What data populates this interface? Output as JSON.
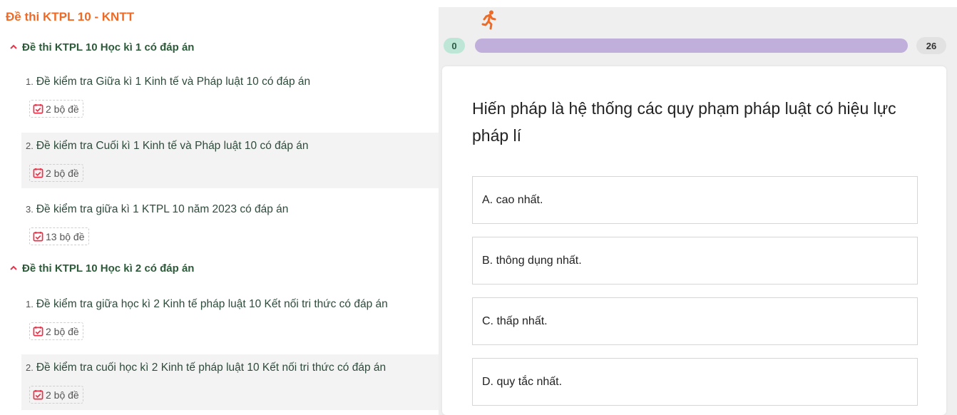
{
  "left": {
    "title": "Đề thi KTPL 10 - KNTT",
    "sections": [
      {
        "heading": "Đề thi KTPL 10 Học kì 1 có đáp án",
        "items": [
          {
            "num": "1.",
            "text": "Đề kiểm tra Giữa kì 1 Kinh tế và Pháp luật 10 có đáp án",
            "count": "2 bộ đề"
          },
          {
            "num": "2.",
            "text": "Đề kiểm tra Cuối kì 1 Kinh tế và Pháp luật 10 có đáp án",
            "count": "2 bộ đề"
          },
          {
            "num": "3.",
            "text": "Đề kiểm tra giữa kì 1 KTPL 10 năm 2023 có đáp án",
            "count": "13 bộ đề"
          }
        ]
      },
      {
        "heading": "Đề thi KTPL 10 Học kì 2 có đáp án",
        "items": [
          {
            "num": "1.",
            "text": "Đề kiểm tra giữa học kì 2 Kinh tế pháp luật 10 Kết nối tri thức có đáp án",
            "count": "2 bộ đề"
          },
          {
            "num": "2.",
            "text": "Đề kiểm tra cuối học kì 2 Kinh tế pháp luật 10 Kết nối tri thức có đáp án",
            "count": "2 bộ đề"
          }
        ]
      }
    ]
  },
  "quiz": {
    "progress_start": "0",
    "progress_end": "26",
    "question": "Hiến pháp là hệ thống các quy phạm pháp luật có hiệu lực pháp lí",
    "options": [
      "A. cao nhất.",
      "B. thông dụng nhất.",
      "C. thấp nhất.",
      "D. quy tắc nhất."
    ]
  },
  "icons": {
    "runner": "running-person-icon",
    "calendar": "calendar-check-icon",
    "chevron": "chevron-up-icon"
  },
  "colors": {
    "title": "#ee6a26",
    "section": "#2d5b3a",
    "badge_icon": "#e8334a",
    "progress": "#c0aedb",
    "start_pill": "#bde6d7"
  }
}
